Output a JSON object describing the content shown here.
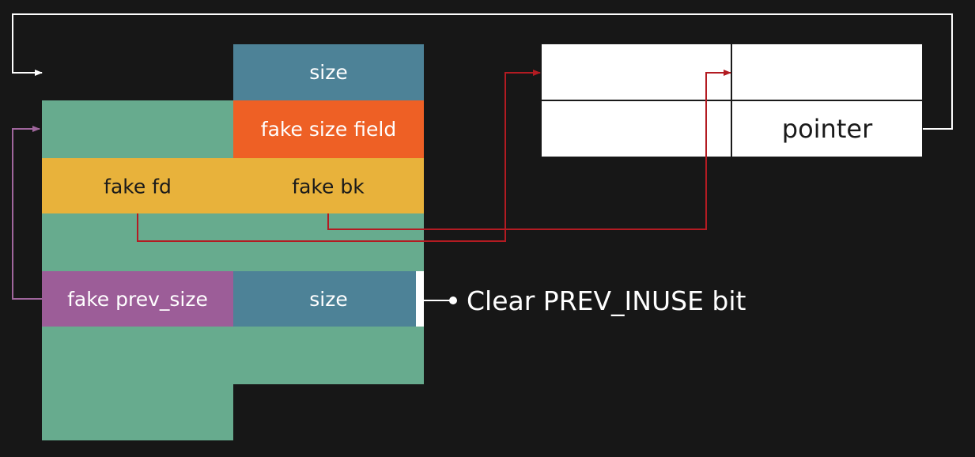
{
  "chunk": {
    "top_size_label": "size",
    "fake_size_field_label": "fake size field",
    "fake_fd_label": "fake fd",
    "fake_bk_label": "fake bk",
    "fake_prev_size_label": "fake prev_size",
    "bottom_size_label": "size"
  },
  "target_table": {
    "pointer_label": "pointer"
  },
  "annotation": {
    "prev_inuse_note": "Clear PREV_INUSE bit"
  },
  "colors": {
    "background": "#171717",
    "chunk_green": "#67ab8e",
    "size_blue": "#4d8297",
    "fake_size_orange": "#ee6025",
    "fake_fd_bk_yellow": "#e8b23b",
    "fake_prev_size_purple": "#9c5d98",
    "fd_bk_arrow_red": "#b31b22",
    "prev_size_arrow_purple": "#a0669d",
    "connector_white": "#ffffff"
  }
}
